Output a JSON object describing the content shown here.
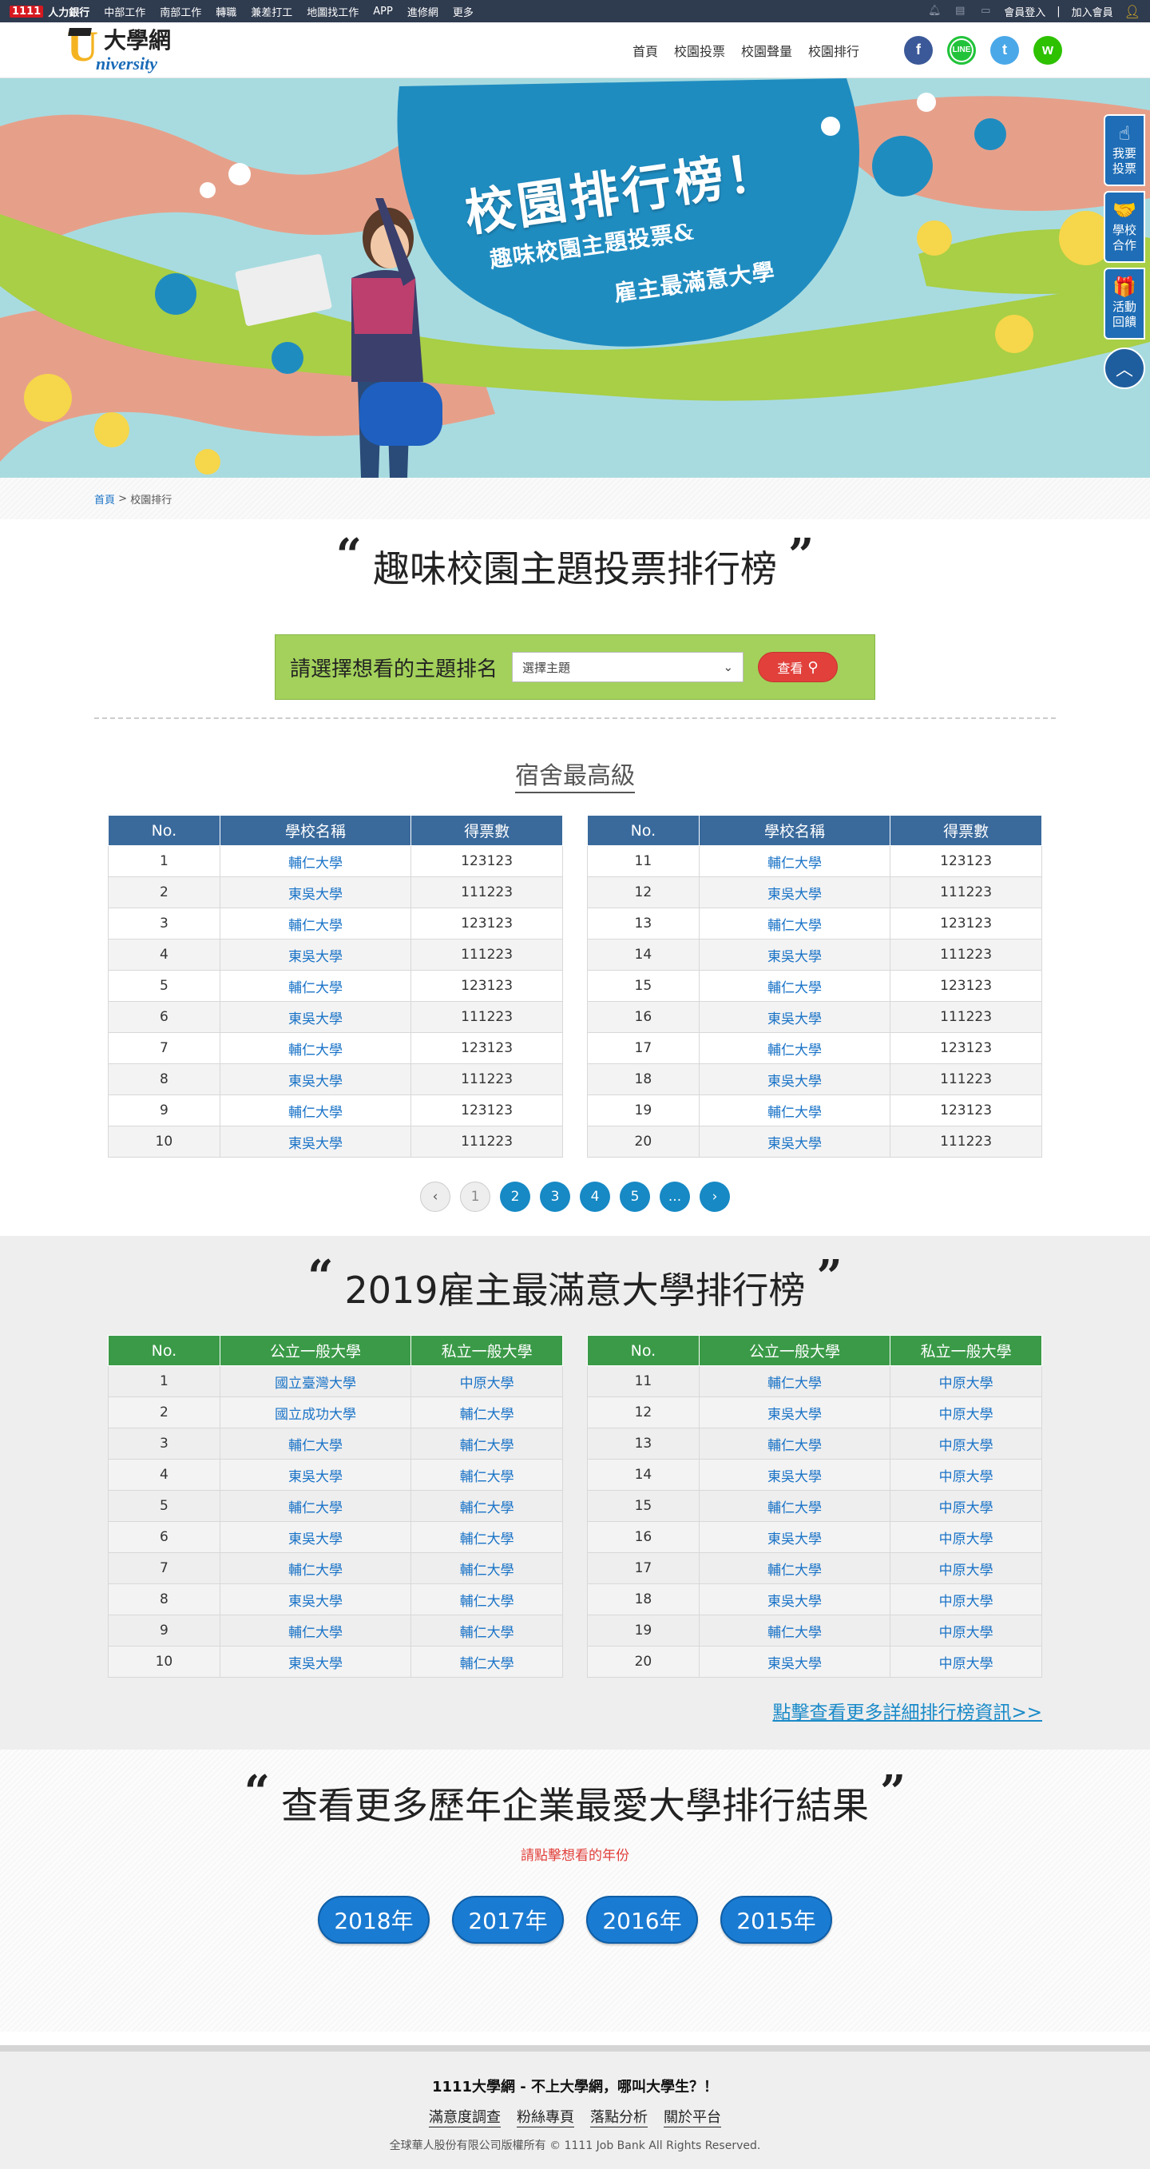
{
  "topbar": {
    "brand_num": "1111",
    "brand_label": "人力銀行",
    "links": [
      "中部工作",
      "南部工作",
      "轉職",
      "兼差打工",
      "地圖找工作",
      "APP",
      "進修網",
      "更多"
    ],
    "login": "會員登入",
    "signup": "加入會員"
  },
  "header": {
    "logo_cn": "大學網",
    "logo_en": "niversity",
    "logo_u": "U",
    "nav": [
      "首頁",
      "校園投票",
      "校園聲量",
      "校園排行"
    ],
    "social": [
      {
        "name": "facebook",
        "glyph": "f",
        "color": "#3b5998"
      },
      {
        "name": "line",
        "glyph": "LINE",
        "color": "#22c33a"
      },
      {
        "name": "twitter",
        "glyph": "t",
        "color": "#4aa8e8"
      },
      {
        "name": "wechat",
        "glyph": "w",
        "color": "#2dc100"
      }
    ]
  },
  "hero": {
    "title": "校園排行榜！",
    "subtitle1": "趣味校園主題投票&",
    "subtitle2": "雇主最滿意大學"
  },
  "side": {
    "items": [
      {
        "icon": "hand-pointer-icon",
        "glyph": "☝",
        "label1": "我要",
        "label2": "投票"
      },
      {
        "icon": "handshake-icon",
        "glyph": "🤝",
        "label1": "學校",
        "label2": "合作"
      },
      {
        "icon": "gift-icon",
        "glyph": "🎁",
        "label1": "活動",
        "label2": "回饋"
      }
    ],
    "top_glyph": "︿"
  },
  "breadcrumb": {
    "home": "首頁",
    "sep": " > ",
    "current": "校園排行"
  },
  "vote": {
    "title": "趣味校園主題投票排行榜",
    "selector_label": "請選擇想看的主題排名",
    "select_placeholder": "選擇主題",
    "search_button": "查看",
    "subhead": "宿舍最高級",
    "headers": [
      "No.",
      "學校名稱",
      "得票數"
    ],
    "left": [
      [
        "1",
        "輔仁大學",
        "123123"
      ],
      [
        "2",
        "東吳大學",
        "111223"
      ],
      [
        "3",
        "輔仁大學",
        "123123"
      ],
      [
        "4",
        "東吳大學",
        "111223"
      ],
      [
        "5",
        "輔仁大學",
        "123123"
      ],
      [
        "6",
        "東吳大學",
        "111223"
      ],
      [
        "7",
        "輔仁大學",
        "123123"
      ],
      [
        "8",
        "東吳大學",
        "111223"
      ],
      [
        "9",
        "輔仁大學",
        "123123"
      ],
      [
        "10",
        "東吳大學",
        "111223"
      ]
    ],
    "right": [
      [
        "11",
        "輔仁大學",
        "123123"
      ],
      [
        "12",
        "東吳大學",
        "111223"
      ],
      [
        "13",
        "輔仁大學",
        "123123"
      ],
      [
        "14",
        "東吳大學",
        "111223"
      ],
      [
        "15",
        "輔仁大學",
        "123123"
      ],
      [
        "16",
        "東吳大學",
        "111223"
      ],
      [
        "17",
        "輔仁大學",
        "123123"
      ],
      [
        "18",
        "東吳大學",
        "111223"
      ],
      [
        "19",
        "輔仁大學",
        "123123"
      ],
      [
        "20",
        "東吳大學",
        "111223"
      ]
    ],
    "pager": {
      "prev": "‹",
      "pages": [
        "1",
        "2",
        "3",
        "4",
        "5",
        "..."
      ],
      "next": "›",
      "current": "1"
    }
  },
  "employer": {
    "title": "2019雇主最滿意大學排行榜",
    "headers": [
      "No.",
      "公立一般大學",
      "私立一般大學"
    ],
    "left": [
      [
        "1",
        "國立臺灣大學",
        "中原大學"
      ],
      [
        "2",
        "國立成功大學",
        "輔仁大學"
      ],
      [
        "3",
        "輔仁大學",
        "輔仁大學"
      ],
      [
        "4",
        "東吳大學",
        "輔仁大學"
      ],
      [
        "5",
        "輔仁大學",
        "輔仁大學"
      ],
      [
        "6",
        "東吳大學",
        "輔仁大學"
      ],
      [
        "7",
        "輔仁大學",
        "輔仁大學"
      ],
      [
        "8",
        "東吳大學",
        "輔仁大學"
      ],
      [
        "9",
        "輔仁大學",
        "輔仁大學"
      ],
      [
        "10",
        "東吳大學",
        "輔仁大學"
      ]
    ],
    "right": [
      [
        "11",
        "輔仁大學",
        "中原大學"
      ],
      [
        "12",
        "東吳大學",
        "中原大學"
      ],
      [
        "13",
        "輔仁大學",
        "中原大學"
      ],
      [
        "14",
        "東吳大學",
        "中原大學"
      ],
      [
        "15",
        "輔仁大學",
        "中原大學"
      ],
      [
        "16",
        "東吳大學",
        "中原大學"
      ],
      [
        "17",
        "輔仁大學",
        "中原大學"
      ],
      [
        "18",
        "東吳大學",
        "中原大學"
      ],
      [
        "19",
        "輔仁大學",
        "中原大學"
      ],
      [
        "20",
        "東吳大學",
        "中原大學"
      ]
    ],
    "more_link": "點擊查看更多詳細排行榜資訊>>"
  },
  "years": {
    "title": "查看更多歷年企業最愛大學排行結果",
    "note": "請點擊想看的年份",
    "items": [
      "2018年",
      "2017年",
      "2016年",
      "2015年"
    ]
  },
  "footer": {
    "slogan": "1111大學網 - 不上大學網，哪叫大學生？！",
    "links": [
      "滿意度調查",
      "粉絲專頁",
      "落點分析",
      "關於平台"
    ],
    "copyright": "全球華人股份有限公司版權所有 © 1111 Job Bank All Rights Reserved."
  }
}
